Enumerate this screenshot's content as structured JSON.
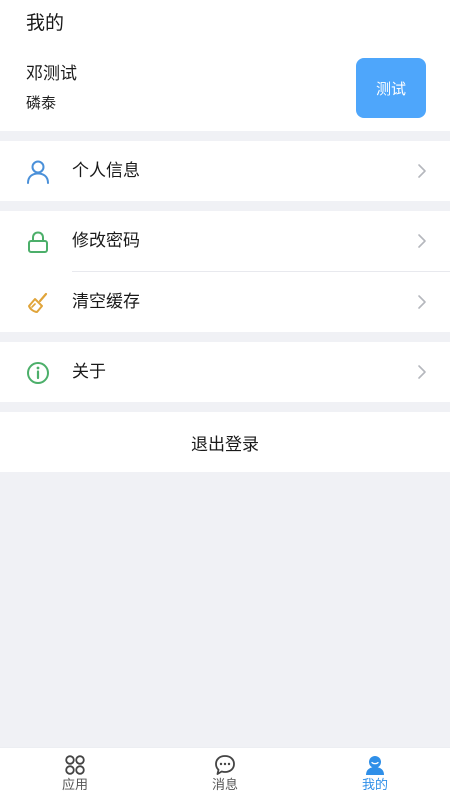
{
  "header": {
    "title": "我的",
    "user_name": "邓测试",
    "company": "磷泰",
    "test_button": "测试"
  },
  "menu": {
    "profile": {
      "label": "个人信息",
      "icon": "person-icon",
      "color": "#4a90d9"
    },
    "password": {
      "label": "修改密码",
      "icon": "lock-icon",
      "color": "#4caf6a"
    },
    "cache": {
      "label": "清空缓存",
      "icon": "broom-icon",
      "color": "#e0a43a"
    },
    "about": {
      "label": "关于",
      "icon": "info-icon",
      "color": "#4caf6a"
    }
  },
  "logout_label": "退出登录",
  "tabbar": {
    "tabs": [
      {
        "label": "应用",
        "icon": "apps-icon",
        "active": false
      },
      {
        "label": "消息",
        "icon": "message-icon",
        "active": false
      },
      {
        "label": "我的",
        "icon": "profile-icon",
        "active": true
      }
    ],
    "active_color": "#2f8fe8"
  }
}
